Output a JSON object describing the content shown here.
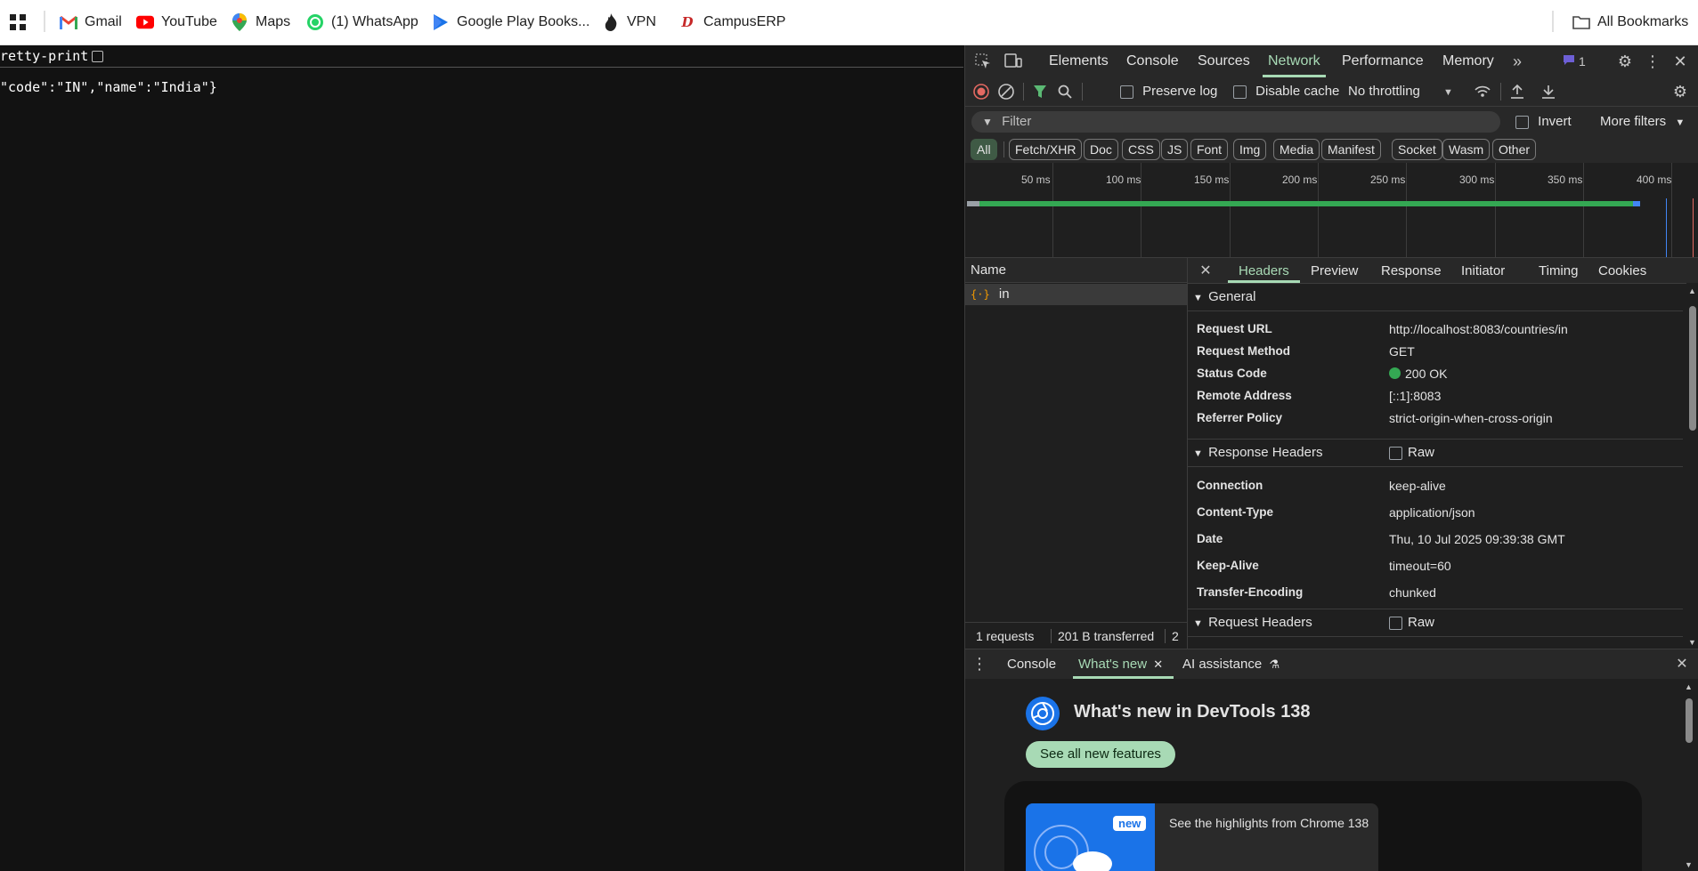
{
  "bookmarks": {
    "items": [
      {
        "label": "Gmail",
        "icon": "gmail-icon"
      },
      {
        "label": "YouTube",
        "icon": "youtube-icon"
      },
      {
        "label": "Maps",
        "icon": "maps-icon"
      },
      {
        "label": "(1) WhatsApp",
        "icon": "whatsapp-icon"
      },
      {
        "label": "Google Play Books...",
        "icon": "play-books-icon"
      },
      {
        "label": "VPN",
        "icon": "vpn-icon"
      },
      {
        "label": "CampusERP",
        "icon": "campuserp-icon"
      }
    ],
    "all_bookmarks": "All Bookmarks"
  },
  "page": {
    "pretty_print_label": "retty-print",
    "json_text": "\"code\":\"IN\",\"name\":\"India\"}"
  },
  "devtools": {
    "tabs": [
      "Elements",
      "Console",
      "Sources",
      "Network",
      "Performance",
      "Memory"
    ],
    "active_tab": "Network",
    "issues_count": "1",
    "toolbar": {
      "preserve_log": "Preserve log",
      "disable_cache": "Disable cache",
      "throttling": "No throttling"
    },
    "filter": {
      "placeholder": "Filter",
      "invert": "Invert",
      "more_filters": "More filters"
    },
    "types": [
      "All",
      "Fetch/XHR",
      "Doc",
      "CSS",
      "JS",
      "Font",
      "Img",
      "Media",
      "Manifest",
      "Socket",
      "Wasm",
      "Other"
    ],
    "timeline_ticks": [
      "50 ms",
      "100 ms",
      "150 ms",
      "200 ms",
      "250 ms",
      "300 ms",
      "350 ms",
      "400 ms"
    ],
    "name_header": "Name",
    "request_name": "in",
    "status": {
      "requests": "1 requests",
      "transferred": "201 B transferred",
      "more": "2"
    },
    "detail_tabs": [
      "Headers",
      "Preview",
      "Response",
      "Initiator",
      "Timing",
      "Cookies"
    ],
    "general": {
      "title": "General",
      "rows": [
        {
          "k": "Request URL",
          "v": "http://localhost:8083/countries/in"
        },
        {
          "k": "Request Method",
          "v": "GET"
        },
        {
          "k": "Status Code",
          "v": "200 OK"
        },
        {
          "k": "Remote Address",
          "v": "[::1]:8083"
        },
        {
          "k": "Referrer Policy",
          "v": "strict-origin-when-cross-origin"
        }
      ]
    },
    "response_headers": {
      "title": "Response Headers",
      "raw": "Raw",
      "rows": [
        {
          "k": "Connection",
          "v": "keep-alive"
        },
        {
          "k": "Content-Type",
          "v": "application/json"
        },
        {
          "k": "Date",
          "v": "Thu, 10 Jul 2025 09:39:38 GMT"
        },
        {
          "k": "Keep-Alive",
          "v": "timeout=60"
        },
        {
          "k": "Transfer-Encoding",
          "v": "chunked"
        }
      ]
    },
    "request_headers": {
      "title": "Request Headers",
      "raw": "Raw"
    },
    "drawer": {
      "tabs": [
        "Console",
        "What's new",
        "AI assistance"
      ],
      "active_tab": "What's new",
      "heading": "What's new in DevTools 138",
      "button": "See all new features",
      "badge": "new",
      "highlights": "See the highlights from Chrome 138"
    }
  }
}
